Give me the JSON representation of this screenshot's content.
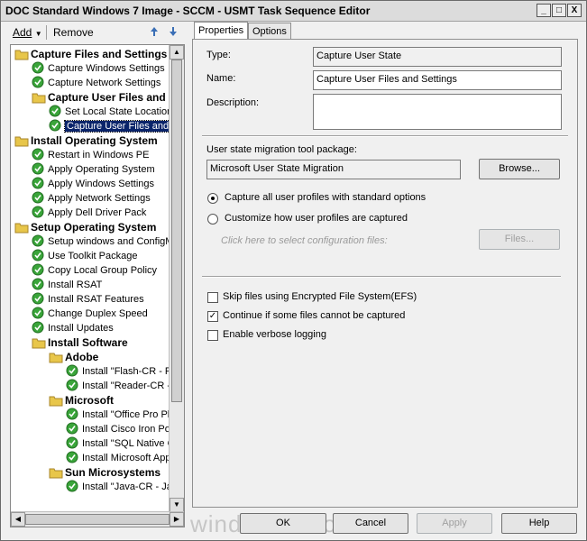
{
  "window": {
    "title": "DOC Standard Windows 7 Image - SCCM - USMT Task Sequence Editor",
    "minimize": "_",
    "maximize": "□",
    "close": "X"
  },
  "toolbar": {
    "add_label": "Add",
    "remove_label": "Remove"
  },
  "tree": {
    "rows": [
      {
        "label": "Capture Files and Settings",
        "type": "group",
        "indent": 0
      },
      {
        "label": "Capture Windows Settings",
        "type": "step",
        "indent": 1
      },
      {
        "label": "Capture Network Settings",
        "type": "step",
        "indent": 1
      },
      {
        "label": "Capture User Files and S",
        "type": "group",
        "indent": 1
      },
      {
        "label": "Set Local State Location",
        "type": "step",
        "indent": 2
      },
      {
        "label": "Capture User Files and S",
        "type": "step",
        "indent": 2,
        "selected": true
      },
      {
        "label": "Install Operating System",
        "type": "group",
        "indent": 0
      },
      {
        "label": "Restart in Windows PE",
        "type": "step",
        "indent": 1
      },
      {
        "label": "Apply Operating System",
        "type": "step",
        "indent": 1
      },
      {
        "label": "Apply Windows Settings",
        "type": "step",
        "indent": 1
      },
      {
        "label": "Apply Network Settings",
        "type": "step",
        "indent": 1
      },
      {
        "label": "Apply Dell Driver Pack",
        "type": "step",
        "indent": 1
      },
      {
        "label": "Setup Operating System",
        "type": "group",
        "indent": 0
      },
      {
        "label": "Setup windows and ConfigM",
        "type": "step",
        "indent": 1
      },
      {
        "label": "Use Toolkit Package",
        "type": "step",
        "indent": 1
      },
      {
        "label": "Copy Local Group Policy",
        "type": "step",
        "indent": 1
      },
      {
        "label": "Install RSAT",
        "type": "step",
        "indent": 1
      },
      {
        "label": "Install RSAT Features",
        "type": "step",
        "indent": 1
      },
      {
        "label": "Change Duplex Speed",
        "type": "step",
        "indent": 1
      },
      {
        "label": "Install Updates",
        "type": "step",
        "indent": 1
      },
      {
        "label": "Install Software",
        "type": "group",
        "indent": 1
      },
      {
        "label": "Adobe",
        "type": "group",
        "indent": 2
      },
      {
        "label": "Install \"Flash-CR - F",
        "type": "step",
        "indent": 3
      },
      {
        "label": "Install \"Reader-CR -",
        "type": "step",
        "indent": 3
      },
      {
        "label": "Microsoft",
        "type": "group",
        "indent": 2
      },
      {
        "label": "Install \"Office Pro Pl",
        "type": "step",
        "indent": 3
      },
      {
        "label": "Install Cisco Iron Po",
        "type": "step",
        "indent": 3
      },
      {
        "label": "Install \"SQL Native C",
        "type": "step",
        "indent": 3
      },
      {
        "label": "Install Microsoft App",
        "type": "step",
        "indent": 3
      },
      {
        "label": "Sun Microsystems",
        "type": "group",
        "indent": 2
      },
      {
        "label": "Install \"Java-CR - Ja",
        "type": "step",
        "indent": 3
      }
    ]
  },
  "tabs": {
    "properties": "Properties",
    "options": "Options"
  },
  "props": {
    "type_label": "Type:",
    "type_value": "Capture User State",
    "name_label": "Name:",
    "name_value": "Capture User Files and Settings",
    "description_label": "Description:",
    "description_value": "",
    "package_label": "User state migration tool package:",
    "package_value": "Microsoft User State Migration",
    "browse_label": "Browse...",
    "radio_all": "Capture all user profiles with standard options",
    "radio_custom": "Customize how user profiles are captured",
    "config_hint": "Click here to select configuration files:",
    "files_label": "Files...",
    "check_efs": "Skip files using Encrypted File System(EFS)",
    "check_continue": "Continue if some files cannot be captured",
    "check_verbose": "Enable verbose logging"
  },
  "buttons": {
    "ok": "OK",
    "cancel": "Cancel",
    "apply": "Apply",
    "help": "Help"
  },
  "watermark": "windows-noob.com",
  "colors": {
    "selection": "#0a246a",
    "step_icon": "#3aa53a",
    "folder_icon": "#e8c64a"
  }
}
